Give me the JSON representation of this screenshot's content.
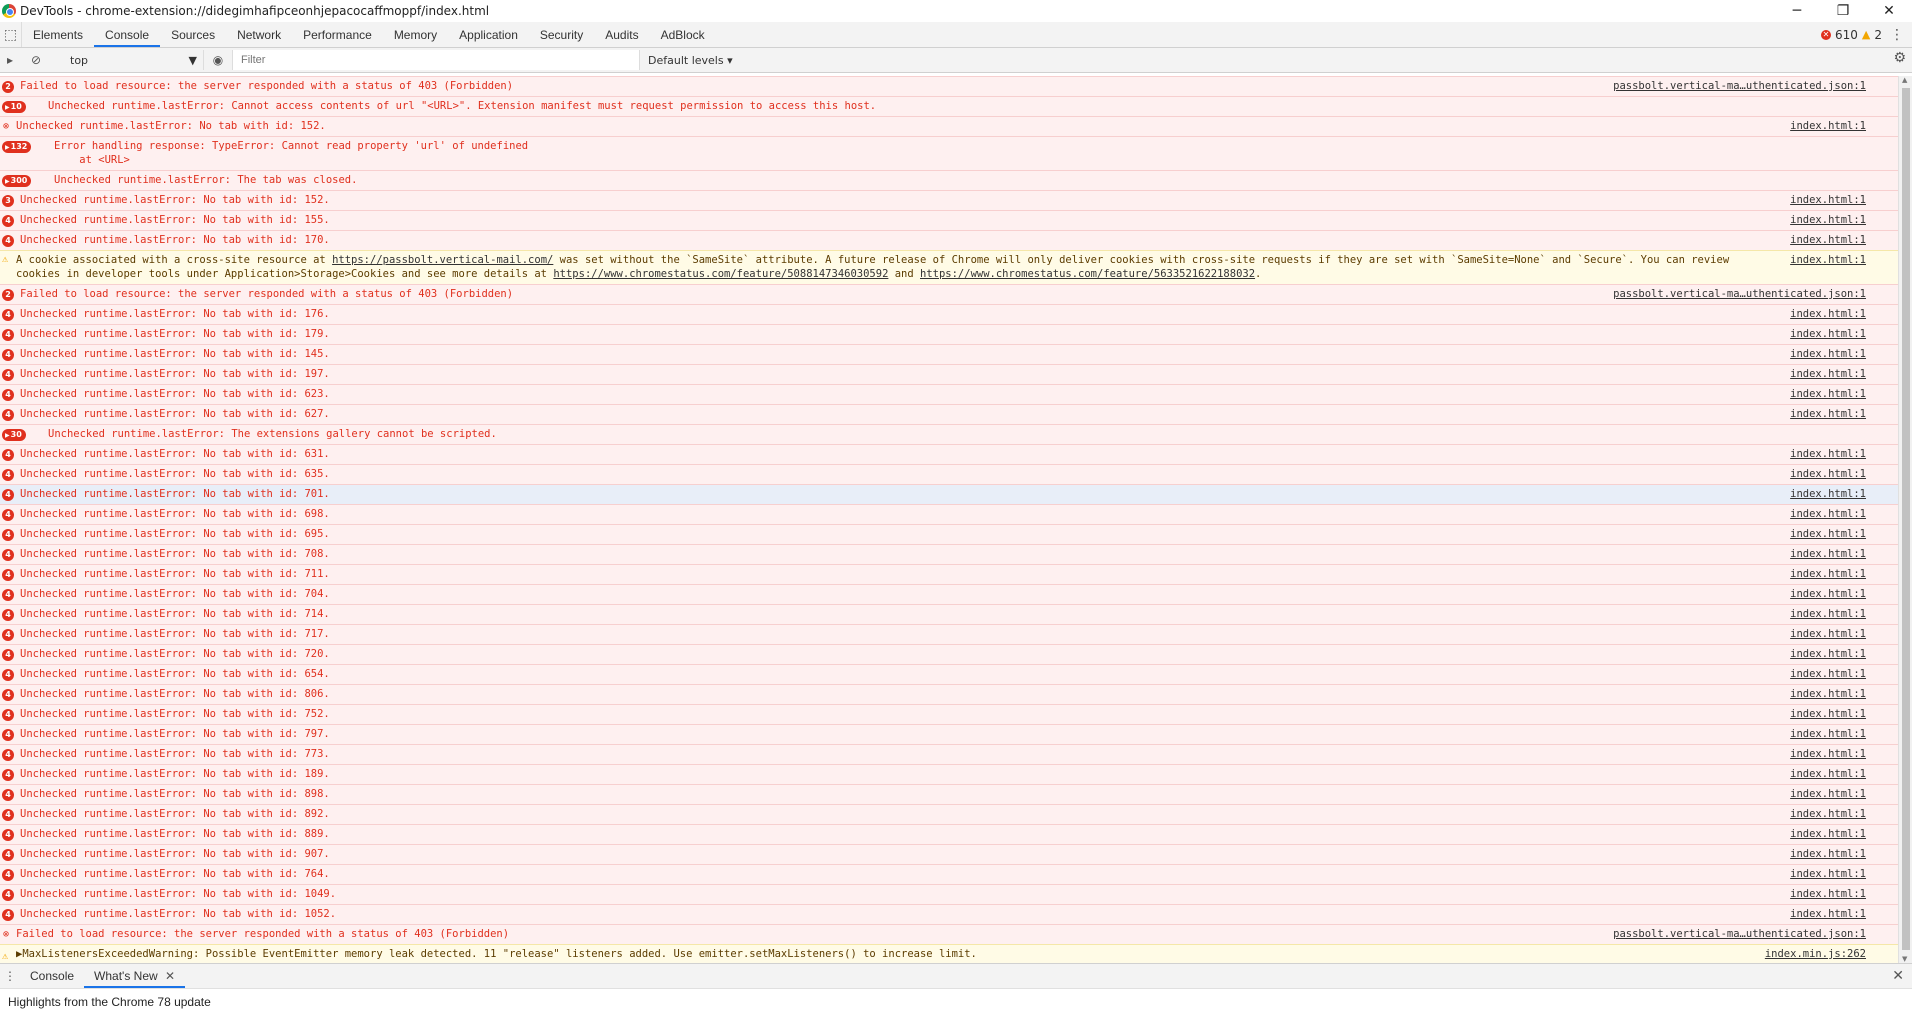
{
  "window": {
    "title": "DevTools - chrome-extension://didegimhafipceonhjepacocaffmoppf/index.html",
    "minimize": "─",
    "restore": "❐",
    "close": "✕"
  },
  "tabs": [
    "Elements",
    "Console",
    "Sources",
    "Network",
    "Performance",
    "Memory",
    "Application",
    "Security",
    "Audits",
    "AdBlock"
  ],
  "active_tab": "Console",
  "counts": {
    "errors": "610",
    "warnings": "2"
  },
  "toolbar": {
    "context": "top",
    "filter_placeholder": "Filter",
    "levels": "Default levels ▾"
  },
  "rows": [
    {
      "type": "error",
      "badge": "2",
      "msg": "Failed to load resource: the server responded with a status of 403 (Forbidden)",
      "src": "passbolt.vertical-ma…uthenticated.json:1"
    },
    {
      "type": "error",
      "badge": "10",
      "wide": true,
      "msg": "Unchecked runtime.lastError: Cannot access contents of url \"<URL>\". Extension manifest must request permission to access this host.",
      "src": ""
    },
    {
      "type": "error",
      "icon": "x",
      "msg": "Unchecked runtime.lastError: No tab with id: 152.",
      "src": "index.html:1"
    },
    {
      "type": "error",
      "badge": "132",
      "wide": true,
      "tall": true,
      "msg": "Error handling response: TypeError: Cannot read property 'url' of undefined\n    at <URL>",
      "src": ""
    },
    {
      "type": "error",
      "badge": "300",
      "wide": true,
      "msg": "Unchecked runtime.lastError: The tab was closed.",
      "src": ""
    },
    {
      "type": "error",
      "badge": "3",
      "msg": "Unchecked runtime.lastError: No tab with id: 152.",
      "src": "index.html:1"
    },
    {
      "type": "error",
      "badge": "4",
      "msg": "Unchecked runtime.lastError: No tab with id: 155.",
      "src": "index.html:1"
    },
    {
      "type": "error",
      "badge": "4",
      "msg": "Unchecked runtime.lastError: No tab with id: 170.",
      "src": "index.html:1"
    },
    {
      "type": "warn",
      "msg_parts": [
        "A cookie associated with a cross-site resource at ",
        "https://passbolt.vertical-mail.com/",
        " was set without the `SameSite` attribute. A future release of Chrome will only deliver cookies with cross-site requests if they are set with `SameSite=None` and `Secure`. You can review cookies in developer tools under Application>Storage>Cookies and see more details at ",
        "https://www.chromestatus.com/feature/5088147346030592",
        " and ",
        "https://www.chromestatus.com/feature/5633521622188032",
        "."
      ],
      "src": "index.html:1"
    },
    {
      "type": "error",
      "badge": "2",
      "msg": "Failed to load resource: the server responded with a status of 403 (Forbidden)",
      "src": "passbolt.vertical-ma…uthenticated.json:1"
    },
    {
      "type": "error",
      "badge": "4",
      "msg": "Unchecked runtime.lastError: No tab with id: 176.",
      "src": "index.html:1"
    },
    {
      "type": "error",
      "badge": "4",
      "msg": "Unchecked runtime.lastError: No tab with id: 179.",
      "src": "index.html:1"
    },
    {
      "type": "error",
      "badge": "4",
      "msg": "Unchecked runtime.lastError: No tab with id: 145.",
      "src": "index.html:1"
    },
    {
      "type": "error",
      "badge": "4",
      "msg": "Unchecked runtime.lastError: No tab with id: 197.",
      "src": "index.html:1"
    },
    {
      "type": "error",
      "badge": "4",
      "msg": "Unchecked runtime.lastError: No tab with id: 623.",
      "src": "index.html:1"
    },
    {
      "type": "error",
      "badge": "4",
      "msg": "Unchecked runtime.lastError: No tab with id: 627.",
      "src": "index.html:1"
    },
    {
      "type": "error",
      "badge": "30",
      "wide": true,
      "msg": "Unchecked runtime.lastError: The extensions gallery cannot be scripted.",
      "src": ""
    },
    {
      "type": "error",
      "badge": "4",
      "msg": "Unchecked runtime.lastError: No tab with id: 631.",
      "src": "index.html:1"
    },
    {
      "type": "error",
      "badge": "4",
      "msg": "Unchecked runtime.lastError: No tab with id: 635.",
      "src": "index.html:1"
    },
    {
      "type": "error",
      "badge": "4",
      "selected": true,
      "msg": "Unchecked runtime.lastError: No tab with id: 701.",
      "src": "index.html:1"
    },
    {
      "type": "error",
      "badge": "4",
      "msg": "Unchecked runtime.lastError: No tab with id: 698.",
      "src": "index.html:1"
    },
    {
      "type": "error",
      "badge": "4",
      "msg": "Unchecked runtime.lastError: No tab with id: 695.",
      "src": "index.html:1"
    },
    {
      "type": "error",
      "badge": "4",
      "msg": "Unchecked runtime.lastError: No tab with id: 708.",
      "src": "index.html:1"
    },
    {
      "type": "error",
      "badge": "4",
      "msg": "Unchecked runtime.lastError: No tab with id: 711.",
      "src": "index.html:1"
    },
    {
      "type": "error",
      "badge": "4",
      "msg": "Unchecked runtime.lastError: No tab with id: 704.",
      "src": "index.html:1"
    },
    {
      "type": "error",
      "badge": "4",
      "msg": "Unchecked runtime.lastError: No tab with id: 714.",
      "src": "index.html:1"
    },
    {
      "type": "error",
      "badge": "4",
      "msg": "Unchecked runtime.lastError: No tab with id: 717.",
      "src": "index.html:1"
    },
    {
      "type": "error",
      "badge": "4",
      "msg": "Unchecked runtime.lastError: No tab with id: 720.",
      "src": "index.html:1"
    },
    {
      "type": "error",
      "badge": "4",
      "msg": "Unchecked runtime.lastError: No tab with id: 654.",
      "src": "index.html:1"
    },
    {
      "type": "error",
      "badge": "4",
      "msg": "Unchecked runtime.lastError: No tab with id: 806.",
      "src": "index.html:1"
    },
    {
      "type": "error",
      "badge": "4",
      "msg": "Unchecked runtime.lastError: No tab with id: 752.",
      "src": "index.html:1"
    },
    {
      "type": "error",
      "badge": "4",
      "msg": "Unchecked runtime.lastError: No tab with id: 797.",
      "src": "index.html:1"
    },
    {
      "type": "error",
      "badge": "4",
      "msg": "Unchecked runtime.lastError: No tab with id: 773.",
      "src": "index.html:1"
    },
    {
      "type": "error",
      "badge": "4",
      "msg": "Unchecked runtime.lastError: No tab with id: 189.",
      "src": "index.html:1"
    },
    {
      "type": "error",
      "badge": "4",
      "msg": "Unchecked runtime.lastError: No tab with id: 898.",
      "src": "index.html:1"
    },
    {
      "type": "error",
      "badge": "4",
      "msg": "Unchecked runtime.lastError: No tab with id: 892.",
      "src": "index.html:1"
    },
    {
      "type": "error",
      "badge": "4",
      "msg": "Unchecked runtime.lastError: No tab with id: 889.",
      "src": "index.html:1"
    },
    {
      "type": "error",
      "badge": "4",
      "msg": "Unchecked runtime.lastError: No tab with id: 907.",
      "src": "index.html:1"
    },
    {
      "type": "error",
      "badge": "4",
      "msg": "Unchecked runtime.lastError: No tab with id: 764.",
      "src": "index.html:1"
    },
    {
      "type": "error",
      "badge": "4",
      "msg": "Unchecked runtime.lastError: No tab with id: 1049.",
      "src": "index.html:1"
    },
    {
      "type": "error",
      "badge": "4",
      "msg": "Unchecked runtime.lastError: No tab with id: 1052.",
      "src": "index.html:1"
    },
    {
      "type": "error",
      "icon": "x",
      "msg": "Failed to load resource: the server responded with a status of 403 (Forbidden)",
      "src": "passbolt.vertical-ma…uthenticated.json:1"
    },
    {
      "type": "warnplain",
      "msg": "▶MaxListenersExceededWarning: Possible EventEmitter memory leak detected. 11 \"release\" listeners added. Use emitter.setMaxListeners() to increase limit.",
      "src": "index.min.js:262"
    }
  ],
  "drawer": {
    "tabs": [
      "Console",
      "What's New"
    ],
    "active": "What's New",
    "tab_close": "✕",
    "close": "✕",
    "content": "Highlights from the Chrome 78 update"
  }
}
